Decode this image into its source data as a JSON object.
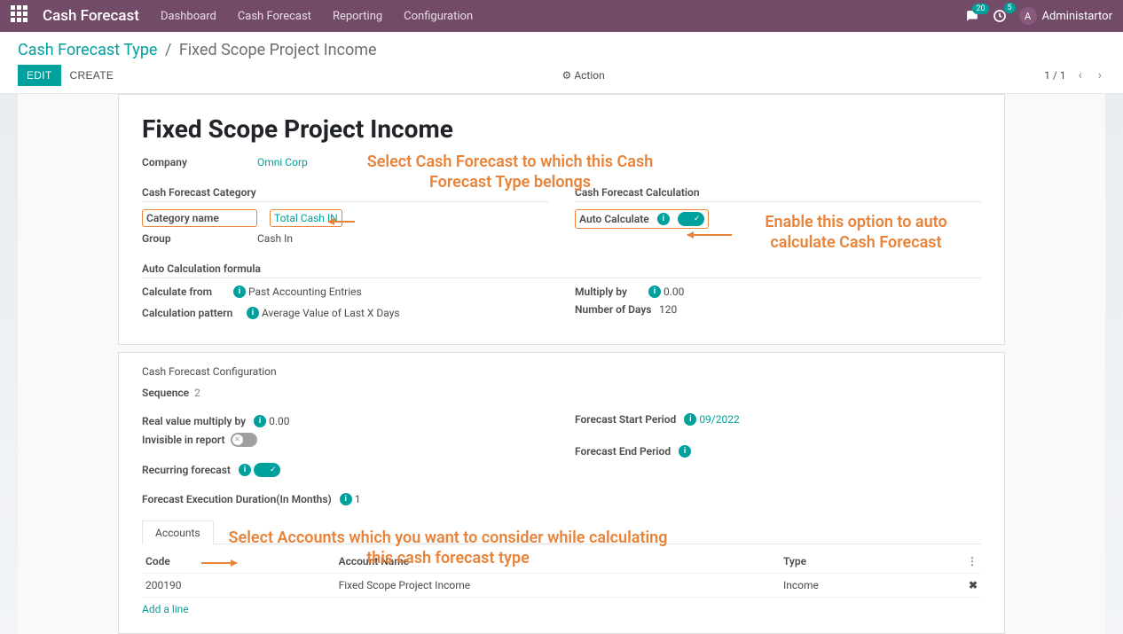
{
  "navbar": {
    "brand": "Cash Forecast",
    "items": [
      "Dashboard",
      "Cash Forecast",
      "Reporting",
      "Configuration"
    ],
    "msg_count": "20",
    "activity_count": "5",
    "user_initial": "A",
    "user_name": "Administartor"
  },
  "breadcrumb": {
    "parent": "Cash Forecast Type",
    "current": "Fixed Scope Project Income"
  },
  "buttons": {
    "edit": "EDIT",
    "create": "CREATE",
    "action": "Action"
  },
  "pager": {
    "text": "1 / 1"
  },
  "form": {
    "title": "Fixed Scope Project Income",
    "company_label": "Company",
    "company_value": "Omni Corp",
    "category_section": "Cash Forecast Category",
    "category_name_label": "Category name",
    "category_name_value": "Total Cash IN",
    "group_label": "Group",
    "group_value": "Cash In",
    "calc_section": "Cash Forecast Calculation",
    "auto_calc_label": "Auto Calculate",
    "formula_section": "Auto Calculation formula",
    "calc_from_label": "Calculate from",
    "calc_from_value": "Past Accounting Entries",
    "calc_pattern_label": "Calculation pattern",
    "calc_pattern_value": "Average Value of Last X Days",
    "multiply_by_label": "Multiply by",
    "multiply_by_value": "0.00",
    "num_days_label": "Number of Days",
    "num_days_value": "120"
  },
  "config": {
    "section": "Cash Forecast Configuration",
    "sequence_label": "Sequence",
    "sequence_value": "2",
    "real_mult_label": "Real value multiply by",
    "real_mult_value": "0.00",
    "invisible_label": "Invisible in report",
    "recurring_label": "Recurring forecast",
    "exec_dur_label": "Forecast Execution Duration(In Months)",
    "exec_dur_value": "1",
    "start_label": "Forecast Start Period",
    "start_value": "09/2022",
    "end_label": "Forecast End Period"
  },
  "tabs": {
    "accounts": "Accounts"
  },
  "table": {
    "h_code": "Code",
    "h_name": "Account Name",
    "h_type": "Type",
    "rows": [
      {
        "code": "200190",
        "name": "Fixed Scope Project Income",
        "type": "Income"
      }
    ],
    "add_line": "Add a line"
  },
  "annotations": {
    "a1": "Select Cash Forecast to which this Cash Forecast Type belongs",
    "a2": "Enable this option to auto calculate Cash Forecast",
    "a3": "Select Accounts which you want to consider while calculating this cash forecast type"
  }
}
